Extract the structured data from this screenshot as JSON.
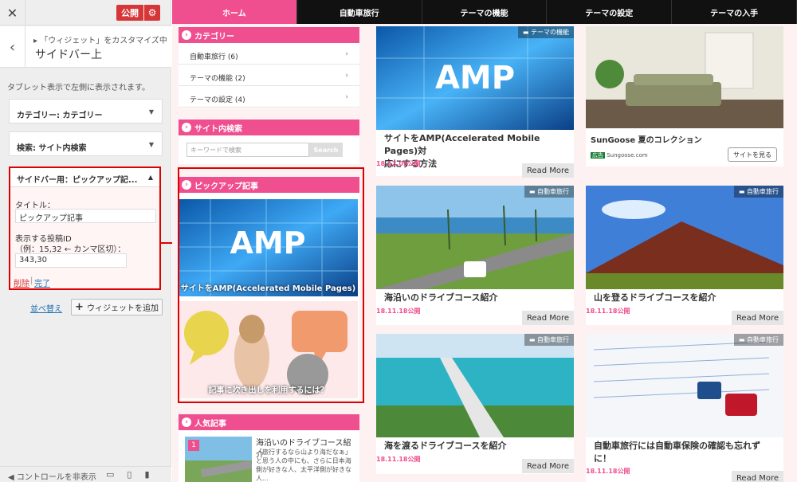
{
  "customizer": {
    "publish_label": "公開",
    "breadcrumb": "「ウィジェット」をカスタマイズ中",
    "section_title": "サイドバー上",
    "description": "タブレット表示で左側に表示されます。",
    "widgets": [
      {
        "label": "カテゴリー: カテゴリー"
      },
      {
        "label": "検索: サイト内検索"
      }
    ],
    "open_widget": {
      "header": "サイドバー用：ピックアップ記...",
      "title_label": "タイトル：",
      "title_value": "ピックアップ記事",
      "ids_label": "表示する投稿ID",
      "ids_hint": "（例：15,32 ← カンマ区切）：",
      "ids_value": "343,30",
      "delete_label": "削除",
      "separator": "|",
      "done_label": "完了"
    },
    "reorder_label": "並べ替え",
    "add_widget_label": "ウィジェットを追加",
    "hide_controls_label": "コントロールを非表示"
  },
  "preview": {
    "nav": [
      "ホーム",
      "自動車旅行",
      "テーマの機能",
      "テーマの設定",
      "テーマの入手"
    ],
    "categories_title": "カテゴリー",
    "categories": [
      "自動車旅行 (6)",
      "テーマの機能 (2)",
      "テーマの設定 (4)"
    ],
    "search_title": "サイト内検索",
    "search_placeholder": "キーワードで検索",
    "search_button": "Search",
    "pickup_title": "ピックアップ記事",
    "pickup_items": [
      {
        "caption": "サイトをAMP(Accelerated Mobile Pages)",
        "image_text": "AMP"
      },
      {
        "caption": "記事に吹き出しを利用するには？"
      }
    ],
    "popular_title": "人気記事",
    "popular_item": {
      "rank": "1",
      "title": "海沿いのドライブコース紹介",
      "excerpt": "「旅行するなら山より海だなぁ」と思う人の中にも、さらに日本海側が好きな人、太平洋側が好きな人..."
    },
    "read_more": "Read More",
    "cards": [
      {
        "category": "テーマの機能",
        "title_line1": "サイトをAMP(Accelerated Mobile Pages)対",
        "title_line2": "応にする方法",
        "date": "18.12.09公開",
        "image_text": "AMP"
      },
      {
        "ad": true,
        "title": "SunGoose 夏のコレクション",
        "ad_label": "広告",
        "domain": "Sungoose.com",
        "button": "サイトを見る"
      },
      {
        "category": "自動車旅行",
        "title_line1": "海沿いのドライブコース紹介",
        "date": "18.11.18公開"
      },
      {
        "category": "自動車旅行",
        "title_line1": "山を登るドライブコースを紹介",
        "date": "18.11.18公開"
      },
      {
        "category": "自動車旅行",
        "title_line1": "海を渡るドライブコースを紹介",
        "date": "18.11.18公開"
      },
      {
        "category": "自動車旅行",
        "title_line1": "自動車旅行には自動車保険の確認も忘れず",
        "title_line2": "に！",
        "date": "18.11.18公開"
      }
    ]
  }
}
